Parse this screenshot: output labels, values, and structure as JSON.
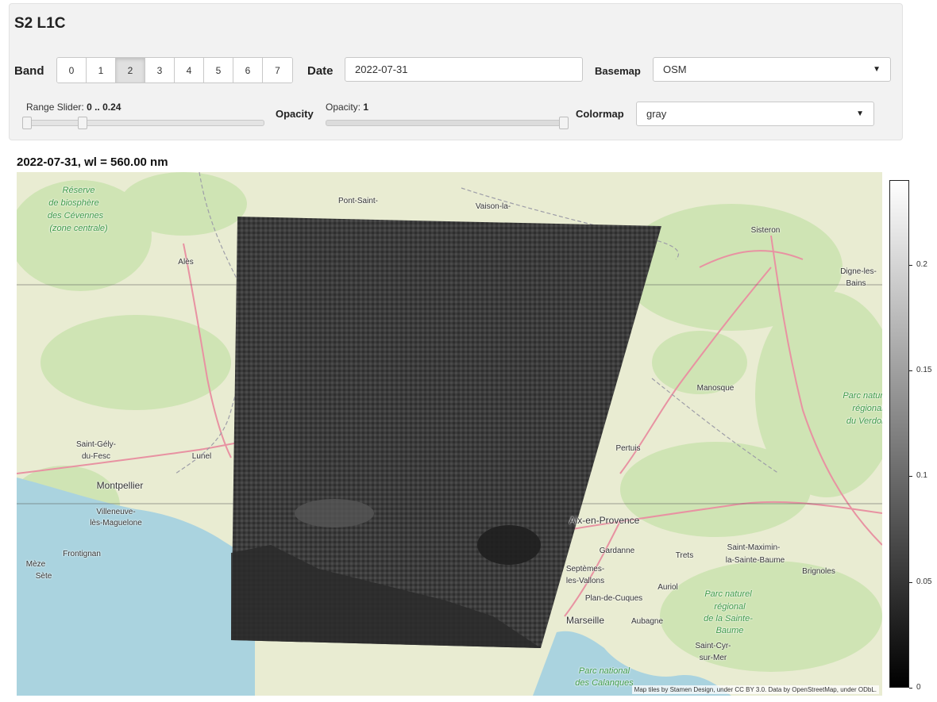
{
  "panel": {
    "title": "S2 L1C",
    "band_label": "Band",
    "bands": [
      "0",
      "1",
      "2",
      "3",
      "4",
      "5",
      "6",
      "7"
    ],
    "band_selected": 2,
    "date_label": "Date",
    "date_value": "2022-07-31",
    "basemap_label": "Basemap",
    "basemap_value": "OSM",
    "range_slider_label": "Range Slider:",
    "range_slider_value": "0 .. 0.24",
    "range_low_fraction": 0.0,
    "range_high_fraction": 0.24,
    "opacity_label": "Opacity",
    "opacity_text_label": "Opacity:",
    "opacity_value": "1",
    "opacity_fraction": 1.0,
    "colormap_label": "Colormap",
    "colormap_value": "gray"
  },
  "map": {
    "title": "2022-07-31, wl = 560.00 nm",
    "places": [
      {
        "name": "Réserve",
        "style": "park"
      },
      {
        "name": "de biosphère",
        "style": "park"
      },
      {
        "name": "des Cévennes",
        "style": "park"
      },
      {
        "name": "(zone centrale)",
        "style": "park"
      },
      {
        "name": "Pont-Saint-",
        "style": "town"
      },
      {
        "name": "Vaison-la-",
        "style": "town"
      },
      {
        "name": "Sisteron",
        "style": "town"
      },
      {
        "name": "Alès",
        "style": "town"
      },
      {
        "name": "Digne-les-",
        "style": "town"
      },
      {
        "name": "Bains",
        "style": "town"
      },
      {
        "name": "Manosque",
        "style": "town"
      },
      {
        "name": "Parc naturel",
        "style": "park"
      },
      {
        "name": "régional",
        "style": "park"
      },
      {
        "name": "du Verdon",
        "style": "park"
      },
      {
        "name": "Saint-Gély-",
        "style": "town"
      },
      {
        "name": "du-Fesc",
        "style": "town"
      },
      {
        "name": "Lunel",
        "style": "town"
      },
      {
        "name": "Pertuis",
        "style": "town"
      },
      {
        "name": "Montpellier",
        "style": "city"
      },
      {
        "name": "Villeneuve-",
        "style": "town"
      },
      {
        "name": "lès-Maguelone",
        "style": "town"
      },
      {
        "name": "Aix-en-Provence",
        "style": "city"
      },
      {
        "name": "Frontignan",
        "style": "town"
      },
      {
        "name": "Gardanne",
        "style": "town"
      },
      {
        "name": "Trets",
        "style": "town"
      },
      {
        "name": "Saint-Maximin-",
        "style": "town"
      },
      {
        "name": "la-Sainte-Baume",
        "style": "town"
      },
      {
        "name": "Brignoles",
        "style": "town"
      },
      {
        "name": "Mèze",
        "style": "town"
      },
      {
        "name": "Sète",
        "style": "town"
      },
      {
        "name": "Septèmes-",
        "style": "town"
      },
      {
        "name": "les-Vallons",
        "style": "town"
      },
      {
        "name": "Plan-de-Cuques",
        "style": "town"
      },
      {
        "name": "Auriol",
        "style": "town"
      },
      {
        "name": "Parc naturel",
        "style": "park"
      },
      {
        "name": "régional",
        "style": "park"
      },
      {
        "name": "de la Sainte-",
        "style": "park"
      },
      {
        "name": "Baume",
        "style": "park"
      },
      {
        "name": "Marseille",
        "style": "city"
      },
      {
        "name": "Aubagne",
        "style": "town"
      },
      {
        "name": "Parc national",
        "style": "park"
      },
      {
        "name": "des Calanques",
        "style": "park"
      },
      {
        "name": "Saint-Cyr-",
        "style": "town"
      },
      {
        "name": "sur-Mer",
        "style": "town"
      }
    ],
    "attribution": "Map tiles by Stamen Design, under CC BY 3.0. Data by OpenStreetMap, under ODbL."
  },
  "colorbar": {
    "ticks": [
      "0",
      "0.05",
      "0.1",
      "0.15",
      "0.2"
    ],
    "tick_values": [
      0,
      0.05,
      0.1,
      0.15,
      0.2
    ],
    "min": 0,
    "max": 0.24,
    "colormap": "gray"
  },
  "colors": {
    "land": "#e9ecd2",
    "forest": "#cfe4b4",
    "sea": "#aad3df",
    "road": "#e892a2",
    "border": "#9e9ea8",
    "park_text": "#3f9a4a",
    "town_text": "#333333",
    "overlay_dark": "#3a3a3a"
  }
}
